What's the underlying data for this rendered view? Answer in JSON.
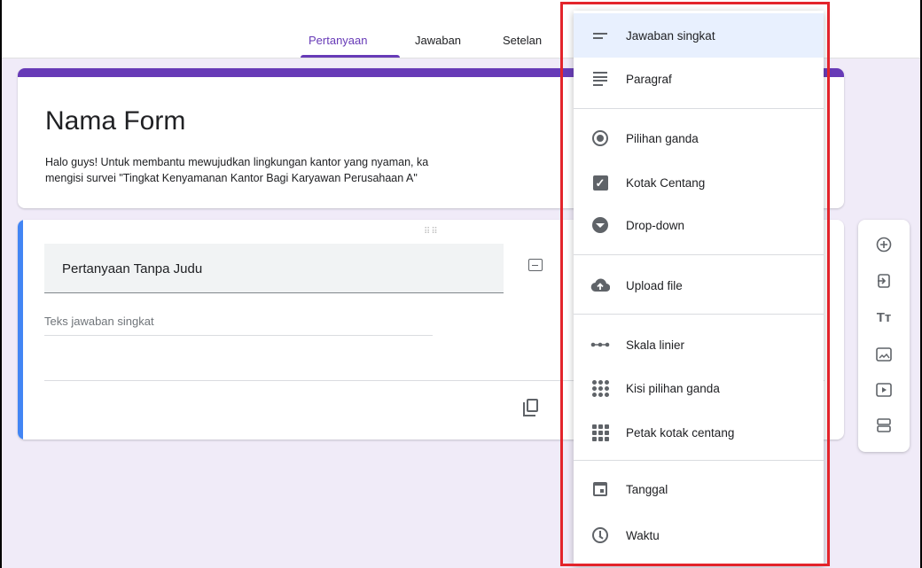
{
  "tabs": [
    {
      "label": "Pertanyaan",
      "active": true
    },
    {
      "label": "Jawaban",
      "active": false
    },
    {
      "label": "Setelan",
      "active": false
    }
  ],
  "form": {
    "title": "Nama Form",
    "description": "Halo guys! Untuk membantu mewujudkan lingkungan kantor yang nyaman, ka\nmengisi survei \"Tingkat Kenyamanan Kantor Bagi Karyawan Perusahaan A\""
  },
  "question": {
    "title": "Pertanyaan Tanpa Judu",
    "answer_placeholder": "Teks jawaban singkat"
  },
  "side_toolbar": {
    "icons": [
      "add-question-icon",
      "import-questions-icon",
      "add-title-icon",
      "add-image-icon",
      "add-video-icon",
      "add-section-icon"
    ]
  },
  "question_type_menu": {
    "items": [
      {
        "label": "Jawaban singkat",
        "icon": "short-answer-icon",
        "selected": true
      },
      {
        "label": "Paragraf",
        "icon": "paragraph-icon",
        "selected": false
      },
      {
        "label": "Pilihan ganda",
        "icon": "radio-icon",
        "selected": false
      },
      {
        "label": "Kotak Centang",
        "icon": "checkbox-icon",
        "selected": false
      },
      {
        "label": "Drop-down",
        "icon": "dropdown-icon",
        "selected": false
      },
      {
        "label": "Upload file",
        "icon": "cloud-upload-icon",
        "selected": false
      },
      {
        "label": "Skala linier",
        "icon": "linear-scale-icon",
        "selected": false
      },
      {
        "label": "Kisi pilihan ganda",
        "icon": "multiple-choice-grid-icon",
        "selected": false
      },
      {
        "label": "Petak kotak centang",
        "icon": "checkbox-grid-icon",
        "selected": false
      },
      {
        "label": "Tanggal",
        "icon": "calendar-icon",
        "selected": false
      },
      {
        "label": "Waktu",
        "icon": "clock-icon",
        "selected": false
      }
    ]
  },
  "colors": {
    "accent": "#673ab7",
    "question_stripe": "#4285f4",
    "background": "#f0ebf8",
    "annotation_box": "#e3242b",
    "selected_item": "#e8f0fe"
  }
}
